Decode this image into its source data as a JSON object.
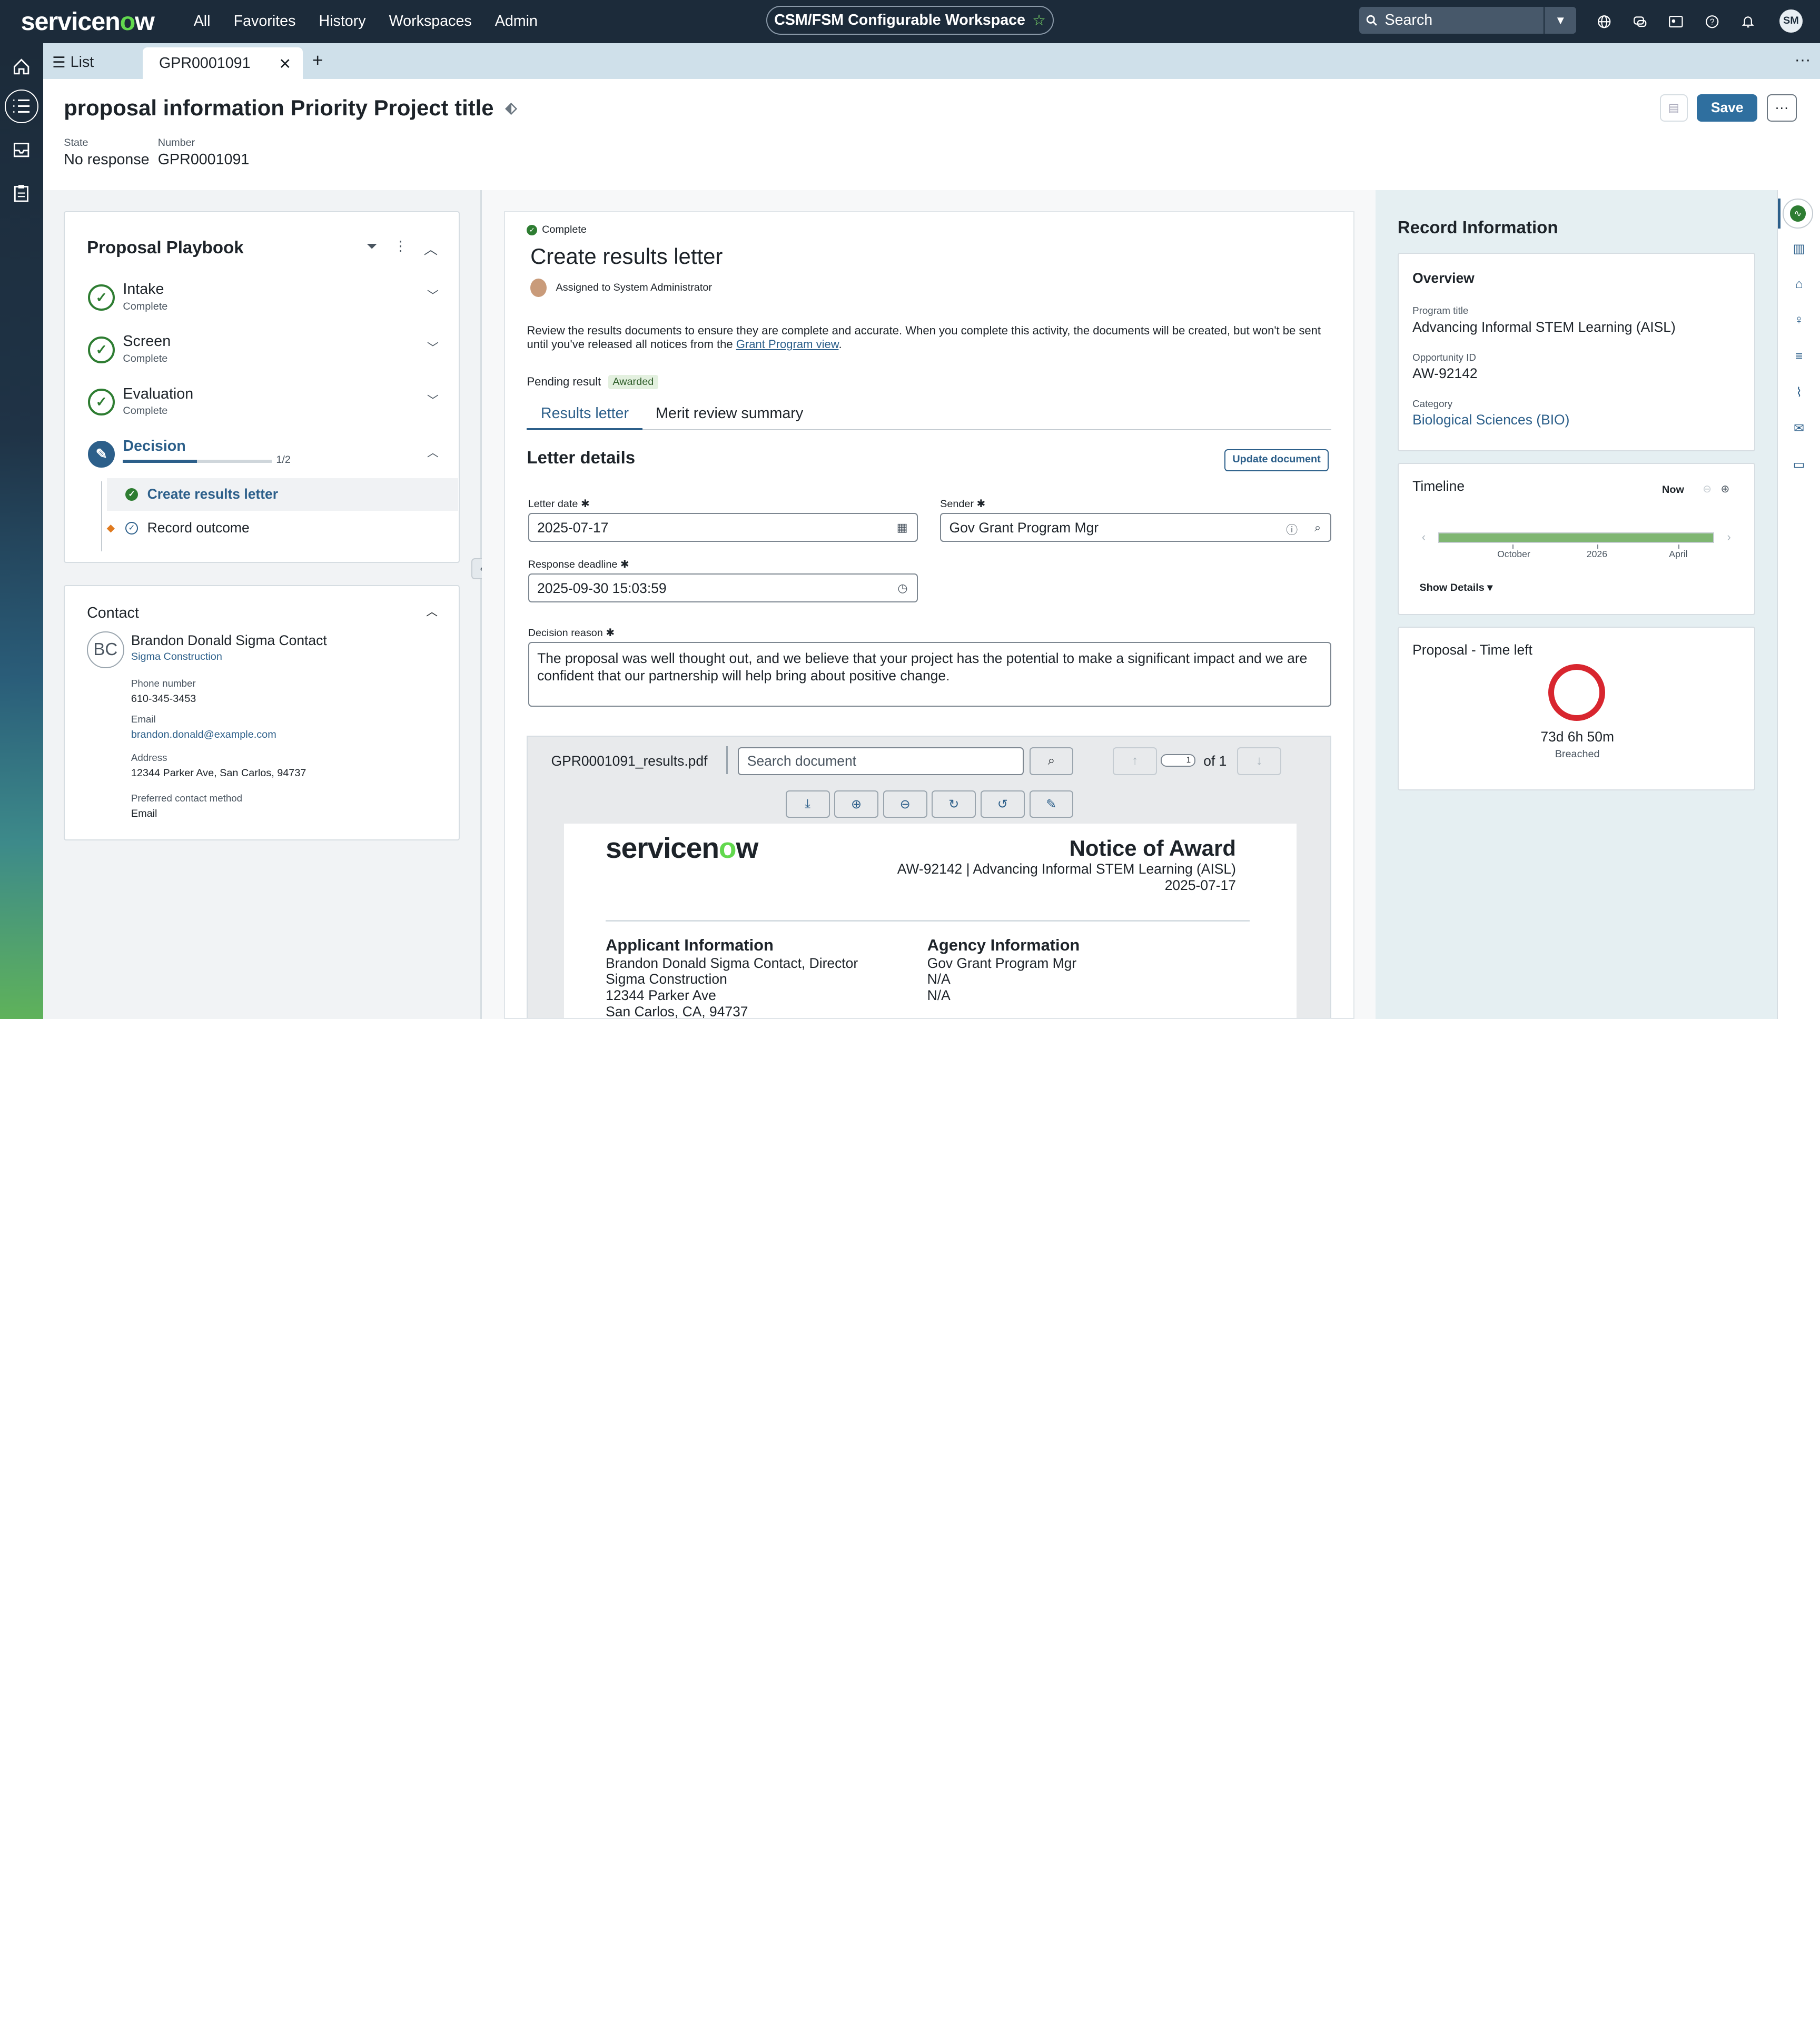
{
  "brand": {
    "logo_pre": "servicen",
    "logo_o": "o",
    "logo_post": "w"
  },
  "nav": {
    "all": "All",
    "favorites": "Favorites",
    "history": "History",
    "workspaces": "Workspaces",
    "admin": "Admin"
  },
  "workspace": {
    "name": "CSM/FSM Configurable Workspace",
    "star": "☆"
  },
  "search": {
    "placeholder": "Search"
  },
  "user": {
    "initials": "SM"
  },
  "tabs": {
    "list": "List",
    "active": "GPR0001091"
  },
  "record": {
    "title": "proposal information Priority Project title",
    "state_label": "State",
    "state_value": "No response",
    "number_label": "Number",
    "number_value": "GPR0001091",
    "save": "Save",
    "more": "···"
  },
  "playbook": {
    "title": "Proposal Playbook",
    "steps": [
      {
        "name": "Intake",
        "status": "Complete"
      },
      {
        "name": "Screen",
        "status": "Complete"
      },
      {
        "name": "Evaluation",
        "status": "Complete"
      },
      {
        "name": "Decision",
        "progress_text": "1/2",
        "progress": 0.5
      }
    ],
    "activities": [
      {
        "label": "Create results letter"
      },
      {
        "label": "Record outcome"
      }
    ]
  },
  "contact": {
    "title": "Contact",
    "initials": "BC",
    "name": "Brandon Donald Sigma Contact",
    "company": "Sigma Construction",
    "phone_label": "Phone number",
    "phone": "610-345-3453",
    "email_label": "Email",
    "email": "brandon.donald@example.com",
    "address_label": "Address",
    "address": "12344 Parker Ave, San Carlos, 94737",
    "pref_label": "Preferred contact method",
    "pref": "Email"
  },
  "activity": {
    "status": "Complete",
    "title": "Create results letter",
    "assigned": "Assigned to System Administrator",
    "desc": "Review the results documents to ensure they are complete and accurate. When you complete this activity, the documents will be created, but won't be sent until you've released all notices from the",
    "desc_link": "Grant Program view",
    "desc_end": ".",
    "pending_label": "Pending result",
    "pending_badge": "Awarded",
    "tab1": "Results letter",
    "tab2": "Merit review summary",
    "letter_title": "Letter details",
    "update_btn": "Update document",
    "letter_date_label": "Letter date ✱",
    "letter_date": "2025-07-17",
    "sender_label": "Sender ✱",
    "sender": "Gov Grant Program Mgr",
    "deadline_label": "Response deadline ✱",
    "deadline": "2025-09-30 15:03:59",
    "reason_label": "Decision reason ✱",
    "reason": "The proposal was well thought out, and we believe that your project has the potential to make a significant impact and we are confident that our partnership will help bring about positive change."
  },
  "pdf": {
    "file": "GPR0001091_results.pdf",
    "search_placeholder": "Search document",
    "page": "1",
    "of": "of 1",
    "notice_title": "Notice of Award",
    "notice_line": "AW-92142 | Advancing Informal STEM Learning (AISL)",
    "notice_date": "2025-07-17",
    "applicant_h": "Applicant Information",
    "applicant_lines": [
      "Brandon Donald Sigma Contact, Director",
      "Sigma Construction",
      "12344 Parker Ave",
      "San Carlos, CA, 94737"
    ],
    "agency_h": "Agency Information",
    "agency_lines": [
      "Gov Grant Program Mgr",
      "N/A",
      "N/A"
    ]
  },
  "record_info": {
    "title": "Record Information",
    "overview": "Overview",
    "program_label": "Program title",
    "program": "Advancing Informal STEM Learning (AISL)",
    "opp_label": "Opportunity ID",
    "opp": "AW-92142",
    "cat_label": "Category",
    "cat": "Biological Sciences (BIO)",
    "timeline": "Timeline",
    "now": "Now",
    "tl_labels": [
      "October",
      "2026",
      "April"
    ],
    "show_details": "Show Details ▾",
    "time_left_title": "Proposal - Time left",
    "time_left": "73d 6h 50m",
    "breached": "Breached"
  },
  "colors": {
    "accent": "#2c5f8a",
    "success": "#2e7d32",
    "brand_green": "#62d84e",
    "danger": "#d8262f"
  }
}
